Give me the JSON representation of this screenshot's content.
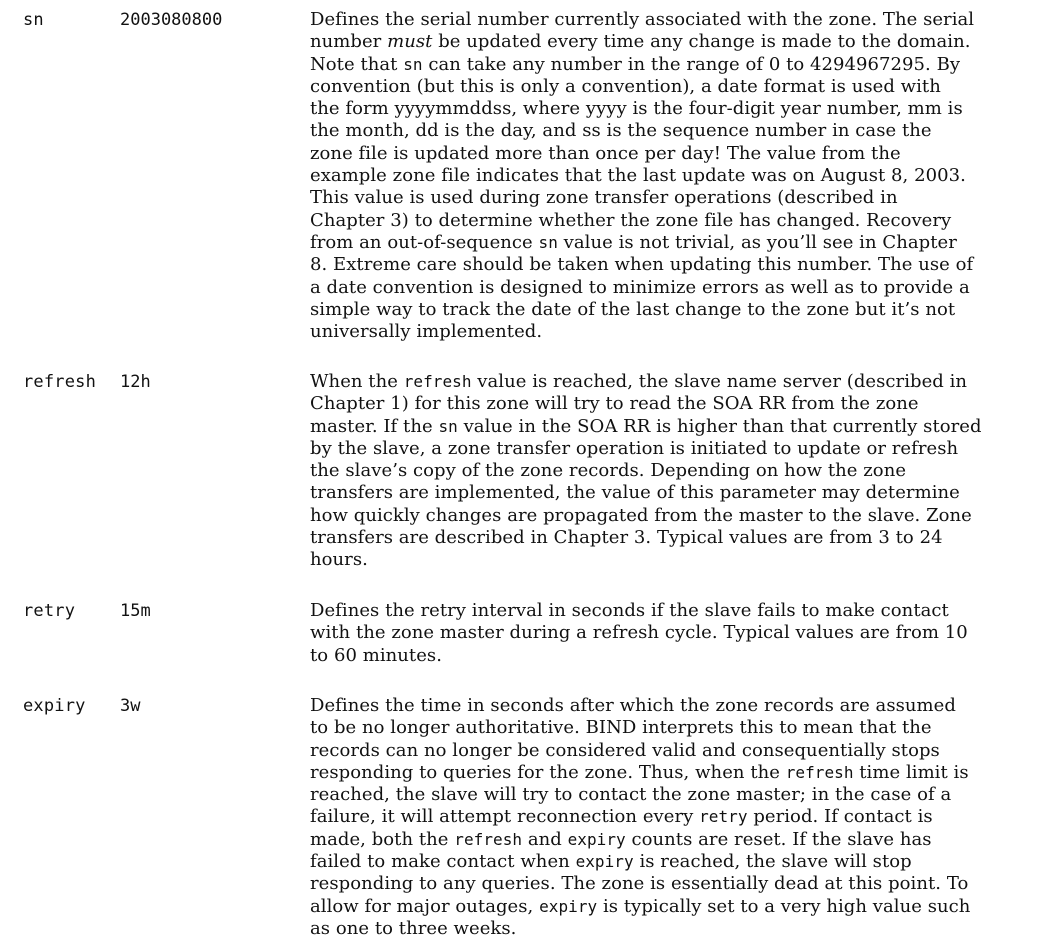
{
  "rows": [
    {
      "field": "sn",
      "value": "2003080800",
      "lines": [
        [
          "Defines the serial number currently associated with the zone. The serial"
        ],
        [
          "number ",
          {
            "i": "must"
          },
          " be updated every time any change is made to the domain."
        ],
        [
          "Note that ",
          {
            "c": "sn"
          },
          " can take any number in the range of 0 to 4294967295. By"
        ],
        [
          "convention (but this is only a convention), a date format is used with"
        ],
        [
          "the form yyyymmddss, where yyyy is the four-digit year number, mm is"
        ],
        [
          "the month, dd is the day, and ss is the sequence number in case the"
        ],
        [
          "zone file is updated more than once per day! The value from the"
        ],
        [
          "example zone file indicates that the last update was on August 8, 2003."
        ],
        [
          "This value is used during zone transfer operations (described in"
        ],
        [
          "Chapter 3) to determine whether the zone file has changed. Recovery"
        ],
        [
          "from an out-of-sequence ",
          {
            "c": "sn"
          },
          " value is not trivial, as you’ll see in Chapter"
        ],
        [
          "8. Extreme care should be taken when updating this number. The use of"
        ],
        [
          "a date convention is designed to minimize errors as well as to provide a"
        ],
        [
          "simple way to track the date of the last change to the zone but it’s not"
        ],
        [
          "universally implemented."
        ]
      ]
    },
    {
      "field": "refresh",
      "value": "12h",
      "lines": [
        [
          "When the ",
          {
            "c": "refresh"
          },
          " value is reached, the slave name server (described in"
        ],
        [
          "Chapter 1) for this zone will try to read the SOA RR from the zone"
        ],
        [
          "master. If the ",
          {
            "c": "sn"
          },
          " value in the SOA RR is higher than that currently stored"
        ],
        [
          "by the slave, a zone transfer operation is initiated to update or refresh"
        ],
        [
          "the slave’s copy of the zone records. Depending on how the zone"
        ],
        [
          "transfers are implemented, the value of this parameter may determine"
        ],
        [
          "how quickly changes are propagated from the master to the slave. Zone"
        ],
        [
          "transfers are described in Chapter 3. Typical values are from 3 to 24"
        ],
        [
          "hours."
        ]
      ]
    },
    {
      "field": "retry",
      "value": "15m",
      "lines": [
        [
          "Defines the retry interval in seconds if the slave fails to make contact"
        ],
        [
          "with the zone master during a refresh cycle. Typical values are from 10"
        ],
        [
          "to 60 minutes."
        ]
      ]
    },
    {
      "field": "expiry",
      "value": "3w",
      "lines": [
        [
          "Defines the time in seconds after which the zone records are assumed"
        ],
        [
          "to be no longer authoritative. BIND interprets this to mean that the"
        ],
        [
          "records can no longer be considered valid and consequentially stops"
        ],
        [
          "responding to queries for the zone. Thus, when the ",
          {
            "c": "refresh"
          },
          " time limit is"
        ],
        [
          "reached, the slave will try to contact the zone master; in the case of a"
        ],
        [
          "failure, it will attempt reconnection every ",
          {
            "c": "retry"
          },
          " period. If contact is"
        ],
        [
          "made, both the ",
          {
            "c": "refresh"
          },
          " and ",
          {
            "c": "expiry"
          },
          " counts are reset. If the slave has"
        ],
        [
          "failed to make contact when ",
          {
            "c": "expiry"
          },
          " is reached, the slave will stop"
        ],
        [
          "responding to any queries. The zone is essentially dead at this point. To"
        ],
        [
          "allow for major outages, ",
          {
            "c": "expiry"
          },
          " is typically set to a very high value such"
        ],
        [
          "as one to three weeks."
        ]
      ]
    }
  ]
}
